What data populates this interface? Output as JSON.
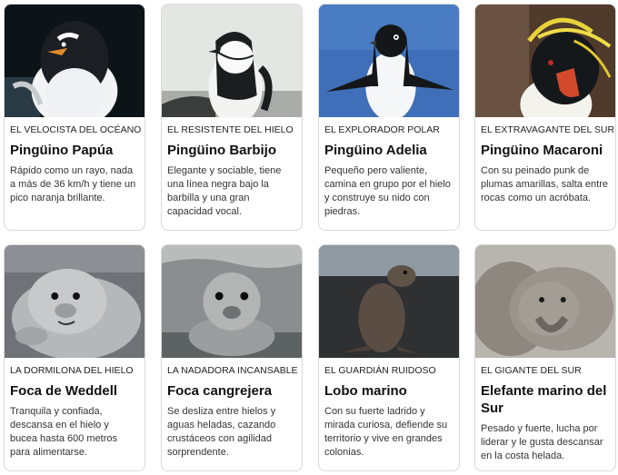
{
  "cards": [
    {
      "tag": "EL VELOCISTA DEL OCÉANO",
      "title": "Pingüino Papúa",
      "desc": "Rápido como un rayo, nada a más de 36 km/h y tiene un pico naranja brillante.",
      "image": "gentoo-penguin-photo"
    },
    {
      "tag": "EL RESISTENTE DEL HIELO",
      "title": "Pingüino Barbijo",
      "desc": "Elegante y sociable, tiene una línea negra bajo la barbilla y una gran capacidad vocal.",
      "image": "chinstrap-penguin-photo"
    },
    {
      "tag": "EL EXPLORADOR POLAR",
      "title": "Pingüino Adelia",
      "desc": "Pequeño pero valiente, camina en grupo por el hielo y construye su nido con piedras.",
      "image": "adelie-penguin-photo"
    },
    {
      "tag": "EL EXTRAVAGANTE DEL SUR",
      "title": "Pingüino Macaroni",
      "desc": "Con su peinado punk de plumas amarillas, salta entre rocas como un acróbata.",
      "image": "macaroni-penguin-photo"
    },
    {
      "tag": "LA DORMILONA DEL HIELO",
      "title": "Foca de Weddell",
      "desc": "Tranquila y confiada, descansa en el hielo y bucea hasta 600 metros para alimentarse.",
      "image": "weddell-seal-photo"
    },
    {
      "tag": "LA NADADORA INCANSABLE",
      "title": "Foca cangrejera",
      "desc": "Se desliza entre hielos y aguas heladas, cazando crustáceos con agilidad sorprendente.",
      "image": "crabeater-seal-photo"
    },
    {
      "tag": "EL GUARDIÁN RUIDOSO",
      "title": "Lobo marino",
      "desc": "Con su fuerte ladrido y mirada curiosa, defiende su territorio y vive en grandes colonias.",
      "image": "fur-seal-photo"
    },
    {
      "tag": "EL GIGANTE DEL SUR",
      "title": "Elefante marino del Sur",
      "desc": "Pesado y fuerte, lucha por liderar y le gusta descansar en la costa helada.",
      "image": "elephant-seal-photo"
    }
  ]
}
